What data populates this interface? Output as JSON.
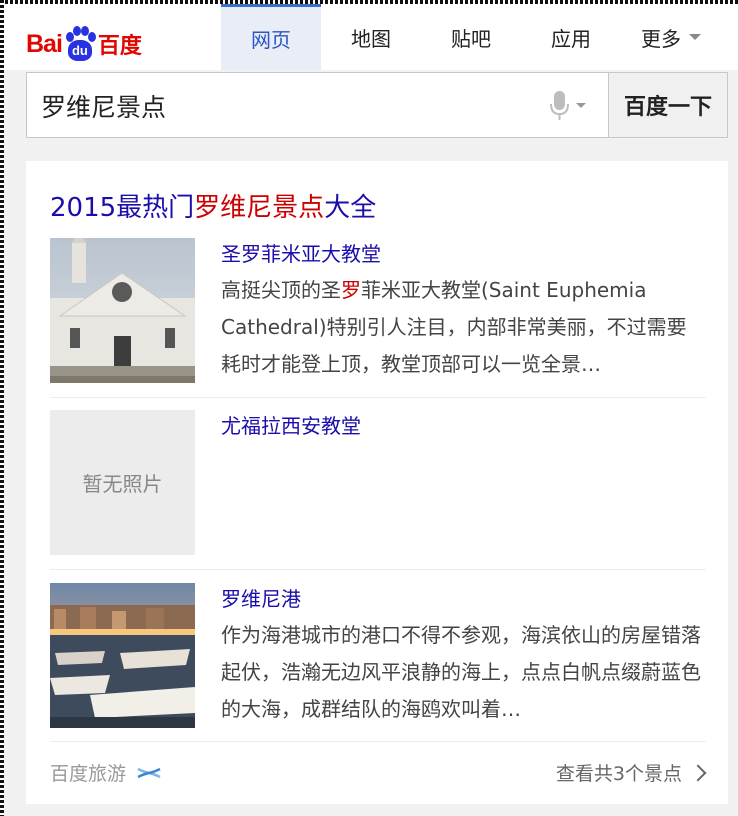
{
  "header": {
    "logo": {
      "latin": "Bai",
      "paw": "du",
      "chinese": "百度"
    },
    "tabs": [
      {
        "label": "网页",
        "active": true
      },
      {
        "label": "地图"
      },
      {
        "label": "贴吧"
      },
      {
        "label": "应用"
      },
      {
        "label": "更多"
      }
    ]
  },
  "search": {
    "query": "罗维尼景点",
    "button_label": "百度一下",
    "mic_icon": "microphone-icon"
  },
  "result_card": {
    "title_prefix": "2015最热门",
    "title_highlight": "罗维尼景点",
    "title_suffix": "大全",
    "items": [
      {
        "title": "圣罗菲米亚大教堂",
        "desc_pre": "高挺尖顶的圣",
        "desc_hl": "罗",
        "desc_post": "菲米亚大教堂(Saint Euphemia Cathedral)特别引人注目，内部非常美丽，不过需要耗时才能登上顶，教堂顶部可以一览全景…",
        "thumbnail": "church-photo"
      },
      {
        "title": "尤福拉西安教堂",
        "no_photo_label": "暂无照片"
      },
      {
        "title": "罗维尼港",
        "desc": "作为海港城市的港口不得不参观，海滨依山的房屋错落起伏，浩瀚无边风平浪静的海上，点点白帆点缀蔚蓝色的大海，成群结队的海鸥欢叫着…",
        "thumbnail": "harbor-photo"
      }
    ],
    "footer_source": "百度旅游",
    "footer_more": "查看共3个景点"
  },
  "colors": {
    "link": "#1a0dab",
    "highlight": "#cc0000",
    "brand_red": "#e10602",
    "brand_blue": "#2932e1"
  }
}
